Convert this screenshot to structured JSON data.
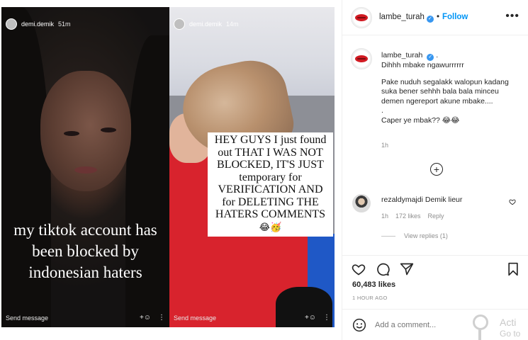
{
  "stories": [
    {
      "username": "demi.demik",
      "time": "51m",
      "caption": "my tiktok account has been blocked by indonesian haters",
      "footer": "Send message"
    },
    {
      "username": "demi.demik",
      "time": "14m",
      "caption": "HEY GUYS I just found out THAT I WAS NOT BLOCKED, IT'S JUST temporary for VERIFICATION AND for DELETING THE HATERS COMMENTS",
      "caption_emoji": "😂🥳",
      "footer": "Send message"
    }
  ],
  "header": {
    "username": "lambe_turah",
    "separator": "•",
    "follow_label": "Follow",
    "more_label": "•••"
  },
  "caption": {
    "username": "lambe_turah",
    "suffix": ".",
    "line1": "Dihhh mbake ngawurrrrrr",
    "line2": "Pake nuduh segalakk walopun kadang suka bener sehhh bala bala minceu demen ngereport akune mbake....",
    "line3": ".",
    "line4": "Caper ye mbak?? 😂😂",
    "time": "1h"
  },
  "comment": {
    "username": "rezaldymajdi",
    "text": "Demik lieur",
    "time": "1h",
    "likes": "172 likes",
    "reply_label": "Reply",
    "view_replies": "View replies (1)"
  },
  "post": {
    "likes": "60,483 likes",
    "ago": "1 HOUR AGO"
  },
  "add_comment": {
    "placeholder": "Add a comment..."
  },
  "watermark": {
    "text": "Acti",
    "sub": "Go to"
  },
  "colors": {
    "accent": "#0095f6",
    "brand_red": "#d11a22",
    "muted": "#8e8e8e",
    "story2_shirt": "#d8232d",
    "story2_blue": "#1f58c6"
  }
}
